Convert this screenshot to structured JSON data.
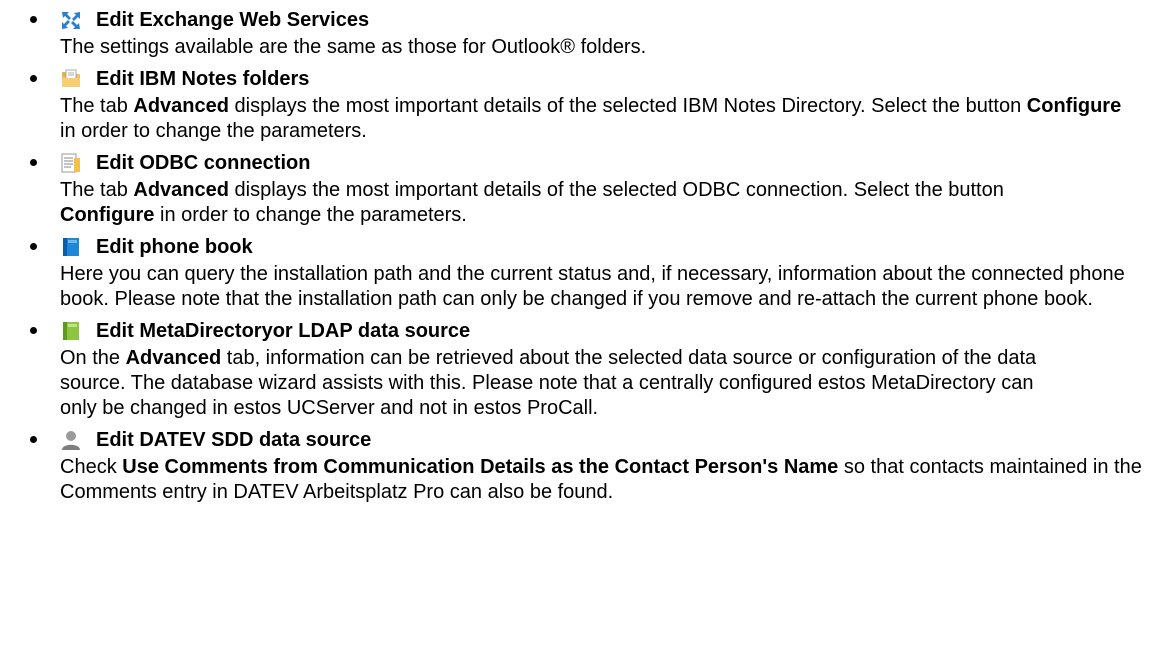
{
  "items": [
    {
      "icon": "exchange-web-services-icon",
      "title": "Edit Exchange Web Services",
      "body": [
        {
          "t": "The settings available are the same as those for Outlook® folders."
        }
      ]
    },
    {
      "icon": "ibm-notes-folder-icon",
      "title": "Edit IBM Notes folders",
      "body": [
        {
          "t": "The tab "
        },
        {
          "t": "Advanced",
          "b": true
        },
        {
          "t": " displays the most important details of the selected IBM Notes Directory. Select the button "
        },
        {
          "t": "Configure",
          "b": true
        },
        {
          "t": " in order to change the parameters."
        }
      ]
    },
    {
      "icon": "odbc-connection-icon",
      "title": "Edit ODBC connection",
      "body": [
        {
          "t": "The tab "
        },
        {
          "t": "Advanced",
          "b": true
        },
        {
          "t": " displays the most important details of the selected ODBC connection. Select the button "
        },
        {
          "t": "Configure",
          "b": true
        },
        {
          "t": " in order to change the parameters."
        }
      ]
    },
    {
      "icon": "phone-book-icon",
      "title": "Edit phone book",
      "body": [
        {
          "t": "Here you can query the installation path and the current status and, if necessary, information about the connected phone book. Please note that the installation path can only be changed if you remove and re-attach the current phone book."
        }
      ]
    },
    {
      "icon": "metadirectory-ldap-icon",
      "title": "Edit MetaDirectoryor LDAP data source",
      "body": [
        {
          "t": "On the "
        },
        {
          "t": "Advanced",
          "b": true
        },
        {
          "t": " tab, information can be retrieved about the selected data source or configuration of the data source. The database wizard assists with this. Please note that a centrally configured estos MetaDirectory can only be changed in estos UCServer and not in estos ProCall."
        }
      ]
    },
    {
      "icon": "datev-sdd-icon",
      "title": "Edit DATEV SDD data source",
      "body": [
        {
          "t": "Check "
        },
        {
          "t": "Use Comments from Communication Details as the Contact Person's Name",
          "b": true
        },
        {
          "t": " so that contacts maintained in the Comments entry in DATEV Arbeitsplatz Pro can also be found."
        }
      ]
    }
  ]
}
